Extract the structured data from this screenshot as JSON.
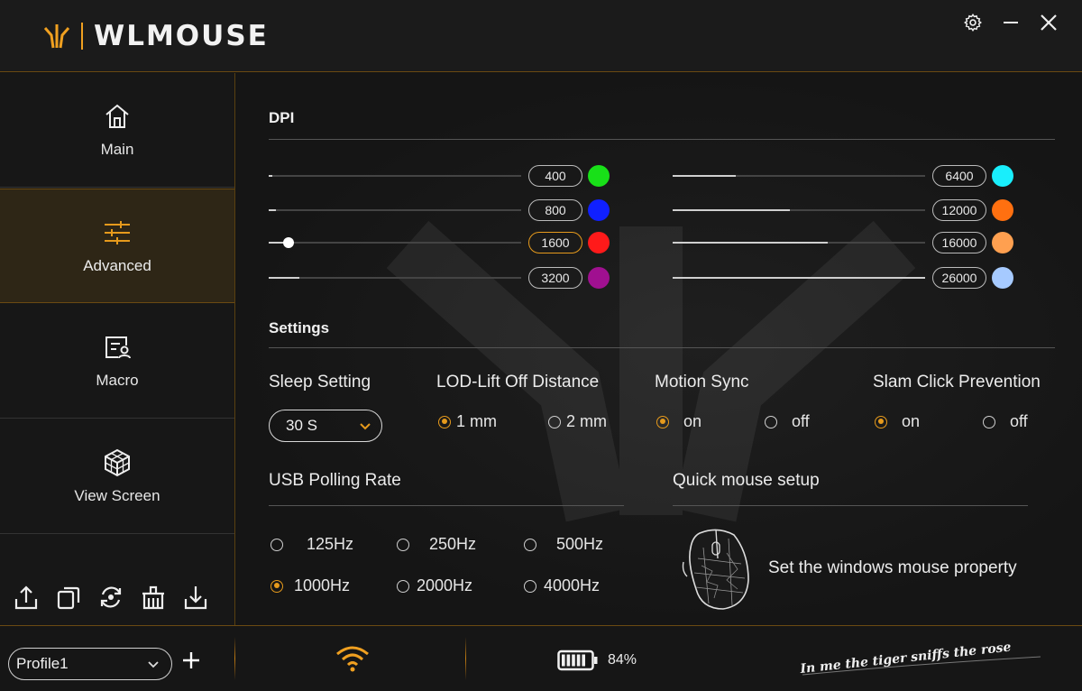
{
  "app": {
    "brand": "WLMOUSE"
  },
  "sidebar": {
    "items": [
      {
        "label": "Main",
        "icon": "home-icon"
      },
      {
        "label": "Advanced",
        "icon": "sliders-icon"
      },
      {
        "label": "Macro",
        "icon": "macro-icon"
      },
      {
        "label": "View Screen",
        "icon": "cube-icon"
      }
    ],
    "active": "Advanced",
    "tools": [
      "export-icon",
      "copy-icon",
      "reset-icon",
      "delete-icon",
      "import-icon"
    ]
  },
  "dpi": {
    "title": "DPI",
    "left": [
      {
        "value": "400",
        "color": "#18e018",
        "fill": 0.0
      },
      {
        "value": "800",
        "color": "#1020ff",
        "fill": 0.0
      },
      {
        "value": "1600",
        "color": "#ff1a1a",
        "fill": 0.08,
        "active": true
      },
      {
        "value": "3200",
        "color": "#a01090",
        "fill": 0.12
      }
    ],
    "right": [
      {
        "value": "6400",
        "color": "#19eefc",
        "fill": 0.25
      },
      {
        "value": "12000",
        "color": "#ff7010",
        "fill": 0.46
      },
      {
        "value": "16000",
        "color": "#ffa050",
        "fill": 0.61
      },
      {
        "value": "26000",
        "color": "#a6caff",
        "fill": 1.0
      }
    ]
  },
  "settings": {
    "title": "Settings",
    "sleep": {
      "title": "Sleep Setting",
      "value": "30 S"
    },
    "lod": {
      "title": "LOD-Lift Off Distance",
      "options": [
        "1 mm",
        "2 mm"
      ],
      "selected": "1 mm"
    },
    "motion_sync": {
      "title": "Motion Sync",
      "options": [
        "on",
        "off"
      ],
      "selected": "on"
    },
    "slam": {
      "title": "Slam Click Prevention",
      "options": [
        "on",
        "off"
      ],
      "selected": "on"
    },
    "polling": {
      "title": "USB Polling Rate",
      "options": [
        "125Hz",
        "250Hz",
        "500Hz",
        "1000Hz",
        "2000Hz",
        "4000Hz"
      ],
      "selected": "1000Hz"
    },
    "quick": {
      "title": "Quick mouse setup",
      "link": "Set the windows mouse property"
    }
  },
  "footer": {
    "profile": "Profile1",
    "battery": "84%",
    "battery_level": 0.84,
    "slogan": "In me the tiger sniffs the rose"
  },
  "colors": {
    "accent": "#e69a1c",
    "background": "#141414"
  }
}
